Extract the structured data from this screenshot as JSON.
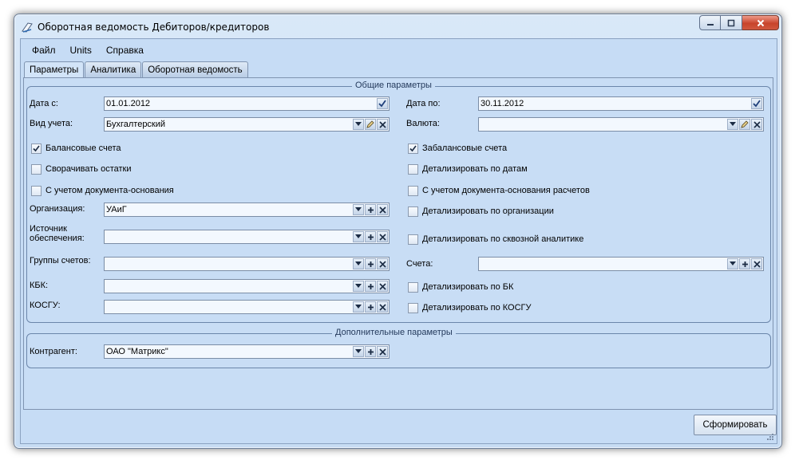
{
  "window": {
    "title": "Оборотная ведомость Дебиторов/кредиторов",
    "icon": "document-pen-icon"
  },
  "menu": [
    "Файл",
    "Units",
    "Справка"
  ],
  "tabs": [
    {
      "label": "Параметры",
      "active": true
    },
    {
      "label": "Аналитика",
      "active": false
    },
    {
      "label": "Оборотная ведомость",
      "active": false
    }
  ],
  "general": {
    "legend": "Общие параметры",
    "date_from": {
      "label": "Дата с:",
      "value": "01.01.2012"
    },
    "date_to": {
      "label": "Дата по:",
      "value": "30.11.2012"
    },
    "account_type": {
      "label": "Вид учета:",
      "value": "Бухгалтерский"
    },
    "currency": {
      "label": "Валюта:",
      "value": ""
    },
    "organization": {
      "label": "Организация:",
      "value": "УАиГ"
    },
    "funding_source": {
      "label": "Источник обеспечения:",
      "value": ""
    },
    "account_groups": {
      "label": "Группы счетов:",
      "value": ""
    },
    "accounts": {
      "label": "Счета:",
      "value": ""
    },
    "kbk": {
      "label": "КБК:",
      "value": ""
    },
    "kosgu": {
      "label": "КОСГУ:",
      "value": ""
    },
    "checkboxes": {
      "balance": {
        "label": "Балансовые счета",
        "checked": true
      },
      "off_balance": {
        "label": "Забалансовые счета",
        "checked": true
      },
      "collapse_balances": {
        "label": "Сворачивать остатки",
        "checked": false
      },
      "detail_dates": {
        "label": "Детализировать по датам",
        "checked": false
      },
      "base_document": {
        "label": "С учетом документа-основания",
        "checked": false
      },
      "base_document_settlements": {
        "label": "С учетом документа-основания расчетов",
        "checked": false
      },
      "detail_org": {
        "label": "Детализировать по организации",
        "checked": false
      },
      "detail_through": {
        "label": "Детализировать по сквозной аналитике",
        "checked": false
      },
      "detail_bk": {
        "label": "Детализировать по БК",
        "checked": false
      },
      "detail_kosgu": {
        "label": "Детализировать по КОСГУ",
        "checked": false
      }
    }
  },
  "additional": {
    "legend": "Дополнительные параметры",
    "counterparty": {
      "label": "Контрагент:",
      "value": "ОАО \"Матрикс\""
    }
  },
  "generate_button": "Сформировать",
  "colors": {
    "accent": "#c6dcf5",
    "close": "#c8442b"
  }
}
